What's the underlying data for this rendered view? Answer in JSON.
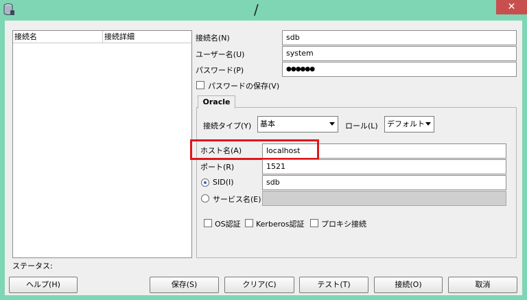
{
  "window": {
    "title": "/",
    "close_glyph": "✕",
    "app_icon": "database-icon"
  },
  "connections_table": {
    "columns": [
      "接続名",
      "接続詳細"
    ]
  },
  "form": {
    "connection_name": {
      "label": "接続名(N)",
      "value": "sdb"
    },
    "username": {
      "label": "ユーザー名(U)",
      "value": "system"
    },
    "password": {
      "label": "パスワード(P)",
      "value": "●●●●●●"
    },
    "save_password": {
      "label": "パスワードの保存(V)",
      "checked": false
    }
  },
  "oracle_tab": {
    "tab_label": "Oracle",
    "connection_type": {
      "label": "接続タイプ(Y)",
      "value": "基本"
    },
    "role": {
      "label": "ロール(L)",
      "value": "デフォルト"
    },
    "hostname": {
      "label": "ホスト名(A)",
      "value": "localhost"
    },
    "port": {
      "label": "ポート(R)",
      "value": "1521"
    },
    "sid": {
      "label": "SID(I)",
      "value": "sdb",
      "selected": true
    },
    "service_name": {
      "label": "サービス名(E)",
      "value": "",
      "selected": false
    },
    "checkboxes": [
      "OS認証",
      "Kerberos認証",
      "プロキシ接続"
    ]
  },
  "status": {
    "label": "ステータス:"
  },
  "buttons": {
    "help": "ヘルプ(H)",
    "save": "保存(S)",
    "clear": "クリア(C)",
    "test": "テスト(T)",
    "connect": "接続(O)",
    "cancel": "取消"
  },
  "highlight_color": "#e0151b"
}
